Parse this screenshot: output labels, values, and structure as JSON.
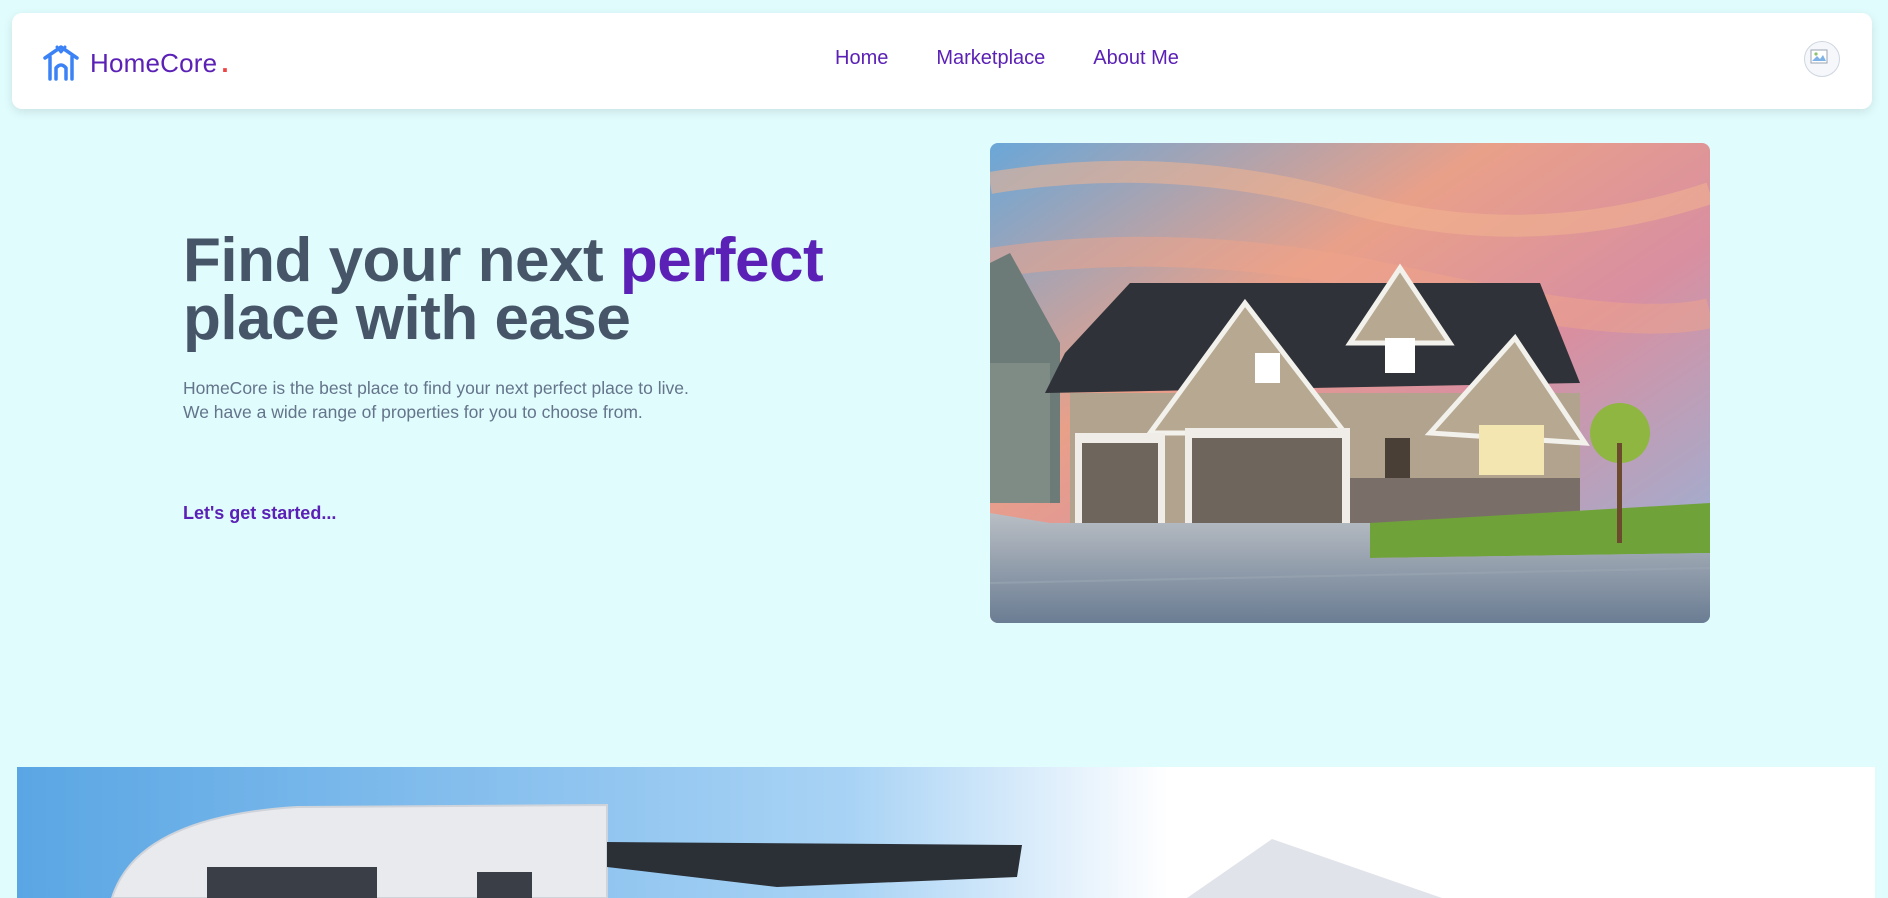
{
  "brand": {
    "name": "HomeCore",
    "dot": ".",
    "logo_icon": "house-roof-icon"
  },
  "nav": {
    "items": [
      {
        "label": "Home"
      },
      {
        "label": "Marketplace"
      },
      {
        "label": "About Me"
      }
    ]
  },
  "user": {
    "avatar_icon": "broken-image-avatar-icon"
  },
  "hero": {
    "title_part1": "Find your next ",
    "title_accent": "perfect",
    "title_part2": "place with ease",
    "desc_line1": "HomeCore is the best place to find your next perfect place to live.",
    "desc_line2": "We have a wide range of properties for you to choose from.",
    "cta_label": "Let's get started...",
    "image_subject": "suburban-house-photo"
  },
  "feature": {
    "image_subject": "modern-building-photo"
  },
  "colors": {
    "background": "#e0fcfd",
    "brand_purple": "#5b21b6",
    "logo_blue": "#3b82f6",
    "title_gray": "#475569",
    "dot_red": "#ef4444"
  }
}
